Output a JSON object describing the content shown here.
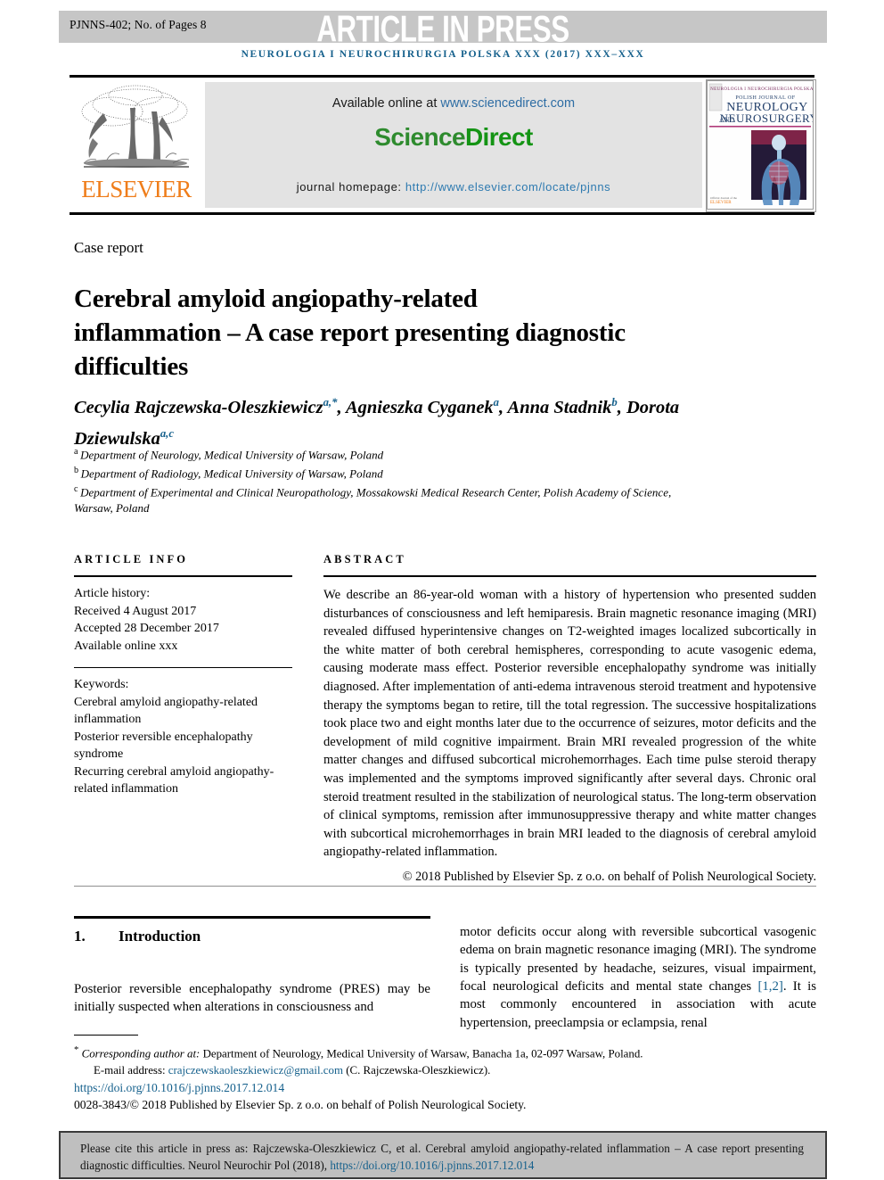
{
  "banner": {
    "runhead": "PJNNS-402; No. of Pages 8",
    "article_in_press": "ARTICLE IN PRESS",
    "band_color": "#c6c6c6"
  },
  "journal_running_head": "NEUROLOGIA I NEUROCHIRURGIA POLSKA XXX (2017) XXX–XXX",
  "masthead": {
    "publisher_name": "ELSEVIER",
    "publisher_color": "#ef7d1a",
    "available_online_label": "Available online at",
    "sciencedirect_url": "www.sciencedirect.com",
    "sciencedirect_logo_part1": "Science",
    "sciencedirect_logo_part2": "Direct",
    "sciencedirect_color": "#149414",
    "homepage_label": "journal homepage:",
    "homepage_url": "http://www.elsevier.com/locate/pjnns",
    "cover": {
      "top_band": "NEUROLOGIA I NEUROCHIRURGIA POLSKA",
      "line1": "POLISH JOURNAL OF",
      "line2": "NEUROLOGY",
      "line3_small": "AND",
      "line3": "NEUROSURGERY",
      "footer": "ELSEVIER"
    }
  },
  "article": {
    "type": "Case report",
    "title": "Cerebral amyloid angiopathy-related inflammation – A case report presenting diagnostic difficulties",
    "authors_html": "Cecylia Rajczewska-Oleszkiewicz<sup>a,*</sup>, Agnieszka Cyganek<sup>a</sup>, Anna Stadnik<sup>b</sup>, Dorota Dziewulska<sup>a,c</sup>",
    "affiliations": [
      {
        "marker": "a",
        "text": "Department of Neurology, Medical University of Warsaw, Poland"
      },
      {
        "marker": "b",
        "text": "Department of Radiology, Medical University of Warsaw, Poland"
      },
      {
        "marker": "c",
        "text": "Department of Experimental and Clinical Neuropathology, Mossakowski Medical Research Center, Polish Academy of Science, Warsaw, Poland"
      }
    ]
  },
  "article_info": {
    "heading": "ARTICLE INFO",
    "history_label": "Article history:",
    "received": "Received 4 August 2017",
    "accepted": "Accepted 28 December 2017",
    "available_online": "Available online xxx",
    "keywords_label": "Keywords:",
    "keywords": [
      "Cerebral amyloid angiopathy-related inflammation",
      "Posterior reversible encephalopathy syndrome",
      "Recurring cerebral amyloid angiopathy-related inflammation"
    ]
  },
  "abstract": {
    "heading": "ABSTRACT",
    "body": "We describe an 86-year-old woman with a history of hypertension who presented sudden disturbances of consciousness and left hemiparesis. Brain magnetic resonance imaging (MRI) revealed diffused hyperintensive changes on T2-weighted images localized subcortically in the white matter of both cerebral hemispheres, corresponding to acute vasogenic edema, causing moderate mass effect. Posterior reversible encephalopathy syndrome was initially diagnosed. After implementation of anti-edema intravenous steroid treatment and hypotensive therapy the symptoms began to retire, till the total regression. The successive hospitalizations took place two and eight months later due to the occurrence of seizures, motor deficits and the development of mild cognitive impairment. Brain MRI revealed progression of the white matter changes and diffused subcortical microhemorrhages. Each time pulse steroid therapy was implemented and the symptoms improved significantly after several days. Chronic oral steroid treatment resulted in the stabilization of neurological status. The long-term observation of clinical symptoms, remission after immunosuppressive therapy and white matter changes with subcortical microhemorrhages in brain MRI leaded to the diagnosis of cerebral amyloid angiopathy-related inflammation.",
    "copyright": "© 2018 Published by Elsevier Sp. z o.o. on behalf of Polish Neurological Society."
  },
  "body": {
    "section_number": "1.",
    "section_title": "Introduction",
    "left_paragraph": "Posterior reversible encephalopathy syndrome (PRES) may be initially suspected when alterations in consciousness and",
    "right_paragraph_pre": "motor deficits occur along with reversible subcortical vasogenic edema on brain magnetic resonance imaging (MRI). The syndrome is typically presented by headache, seizures, visual impairment, focal neurological deficits and mental state changes ",
    "right_reference": "[1,2]",
    "right_paragraph_post": ". It is most commonly encountered in association with acute hypertension, preeclampsia or eclampsia, renal"
  },
  "footnotes": {
    "corresponding_marker": "*",
    "corresponding_label": "Corresponding author at:",
    "corresponding_text": " Department of Neurology, Medical University of Warsaw, Banacha 1a, 02-097 Warsaw, Poland.",
    "email_label": "E-mail address:",
    "email": "crajczewskaoleszkiewicz@gmail.com",
    "email_owner": "(C. Rajczewska-Oleszkiewicz).",
    "doi": "https://doi.org/10.1016/j.pjnns.2017.12.014",
    "issn_line": "0028-3843/© 2018 Published by Elsevier Sp. z o.o. on behalf of Polish Neurological Society."
  },
  "cite_box": {
    "text_pre": "Please cite this article in press as: Rajczewska-Oleszkiewicz C, et al. Cerebral amyloid angiopathy-related inflammation – A case report presenting diagnostic difficulties. Neurol Neurochir Pol (2018), ",
    "doi": "https://doi.org/10.1016/j.pjnns.2017.12.014"
  },
  "colors": {
    "link_blue": "#15608c",
    "elsevier_orange": "#ef7d1a",
    "sciencedirect_green": "#149414",
    "band_gray": "#c6c6c6",
    "cite_gray": "#bfbfbf"
  }
}
